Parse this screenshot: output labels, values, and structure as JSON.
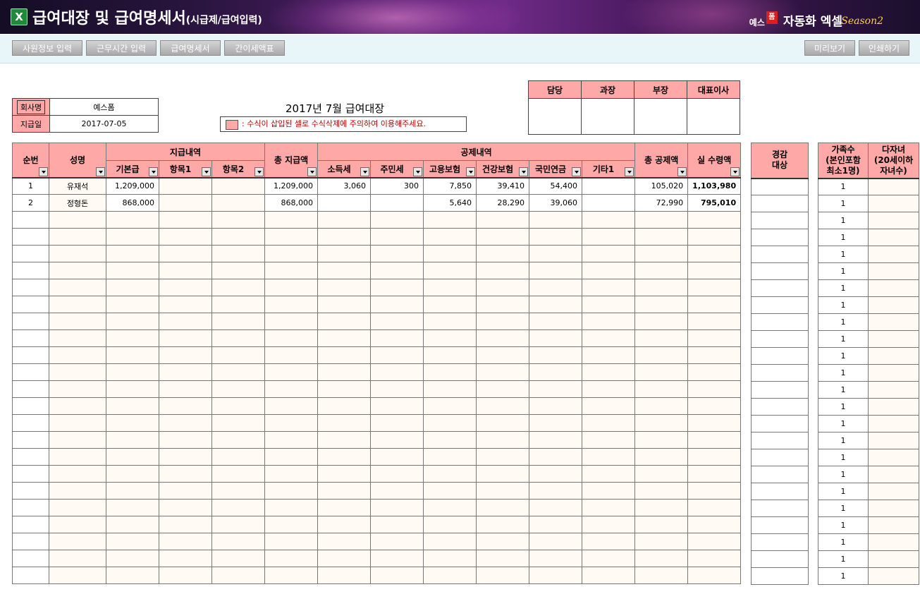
{
  "header": {
    "excel_icon": "X",
    "title": "급여대장 및 급여명세서",
    "title_suffix": "(시급제/급여입력)",
    "brand_prefix": "예스",
    "brand_mark": "폼",
    "brand_name": "자동화 엑셀",
    "brand_season": "Season2"
  },
  "toolbar": {
    "employee_info": "사원정보 입력",
    "work_hours": "근무시간 입력",
    "pay_slip": "급여명세서",
    "tax_table": "간이세액표",
    "preview": "미리보기",
    "print": "인쇄하기"
  },
  "company": {
    "name_label": "회사명",
    "name": "예스폼",
    "paydate_label": "지급일",
    "paydate": "2017-07-05"
  },
  "page_title": "2017년  7월  급여대장",
  "notice": ": 수식이 삽입된 셀로 수식삭제에 주의하여 이용해주세요.",
  "approval": [
    "담당",
    "과장",
    "부장",
    "대표이사"
  ],
  "table": {
    "h_seq": "순번",
    "h_name": "성명",
    "h_pay": "지급내역",
    "h_base": "기본급",
    "h_item1": "항목1",
    "h_item2": "항목2",
    "h_total_pay": "총 지급액",
    "h_deduct": "공제내역",
    "h_income_tax": "소득세",
    "h_resident_tax": "주민세",
    "h_employment": "고용보험",
    "h_health": "건강보험",
    "h_pension": "국민연금",
    "h_other": "기타1",
    "h_total_deduct": "총 공제액",
    "h_net": "실 수령액",
    "h_reduction_1": "경감",
    "h_reduction_2": "대상",
    "h_family_1": "가족수",
    "h_family_2": "(본인포함",
    "h_family_3": "최소1명)",
    "h_children_1": "다자녀",
    "h_children_2": "(20세이하",
    "h_children_3": "자녀수)",
    "rows": [
      {
        "seq": "1",
        "name": "유재석",
        "base": "1,209,000",
        "item1": "",
        "item2": "",
        "total_pay": "1,209,000",
        "income_tax": "3,060",
        "resident_tax": "300",
        "employment": "7,850",
        "health": "39,410",
        "pension": "54,400",
        "other": "",
        "total_deduct": "105,020",
        "net": "1,103,980",
        "reduction": "",
        "family": "1",
        "children": ""
      },
      {
        "seq": "2",
        "name": "정형돈",
        "base": "868,000",
        "item1": "",
        "item2": "",
        "total_pay": "868,000",
        "income_tax": "",
        "resident_tax": "",
        "employment": "5,640",
        "health": "28,290",
        "pension": "39,060",
        "other": "",
        "total_deduct": "72,990",
        "net": "795,010",
        "reduction": "",
        "family": "1",
        "children": ""
      }
    ],
    "empty_family_value": "1",
    "empty_row_count": 22
  }
}
